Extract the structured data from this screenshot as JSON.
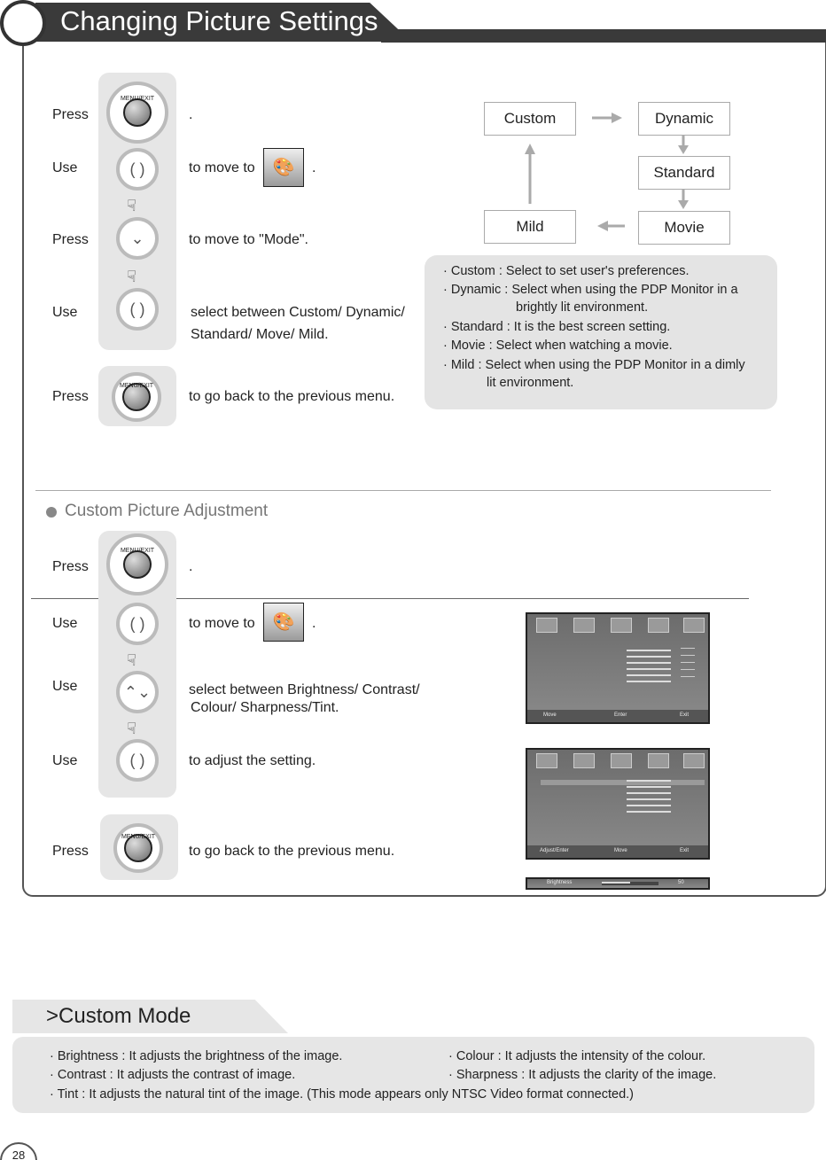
{
  "header": {
    "title": "Changing Picture Settings"
  },
  "steps_top": [
    {
      "verb": "Press",
      "button": "MENU/EXIT",
      "text": "."
    },
    {
      "verb": "Use",
      "text": "to move to",
      "after": "."
    },
    {
      "verb": "Press",
      "text": "to move to \"Mode\"."
    },
    {
      "verb": "Use",
      "text": "select between Custom/ Dynamic/",
      "text2": "Standard/ Move/ Mild."
    },
    {
      "verb": "Press",
      "button": "MENU/EXIT",
      "text": "to go back to the previous menu."
    }
  ],
  "modes": {
    "custom": "Custom",
    "dynamic": "Dynamic",
    "standard": "Standard",
    "movie": "Movie",
    "mild": "Mild"
  },
  "mode_info": [
    "· Custom : Select to set user's preferences.",
    "· Dynamic : Select when using the PDP Monitor  in a",
    "brightly lit environment.",
    "· Standard : It is the best screen setting.",
    "· Movie : Select when watching a movie.",
    "· Mild : Select when using the PDP Monitor in a dimly",
    "lit environment."
  ],
  "section2": {
    "title": "Custom Picture Adjustment"
  },
  "steps_bottom": [
    {
      "verb": "Press",
      "button": "MENU/EXIT",
      "text": "."
    },
    {
      "verb": "Use",
      "text": "to move to",
      "after": "."
    },
    {
      "verb": "Use",
      "text": "select between Brightness/ Contrast/",
      "text2": "Colour/ Sharpness/Tint."
    },
    {
      "verb": "Use",
      "text": "to adjust the setting."
    },
    {
      "verb": "Press",
      "button": "MENU/EXIT",
      "text": "to go back to the previous menu."
    }
  ],
  "osd": {
    "move": "Move",
    "enter": "Enter",
    "exit": "Exit",
    "adjust_enter": "Adjust/Enter",
    "brightness": "Brightness",
    "value": "50"
  },
  "custom_mode": {
    "title": "Custom Mode",
    "items": [
      "· Brightness : It adjusts the brightness of the image.",
      "· Colour : It adjusts the intensity of the colour.",
      "· Contrast : It adjusts the contrast of image.",
      "· Sharpness : It adjusts the clarity of the image.",
      "· Tint : It adjusts the natural tint of the image. (This mode appears only NTSC Video format connected.)"
    ]
  },
  "page_number": "28"
}
